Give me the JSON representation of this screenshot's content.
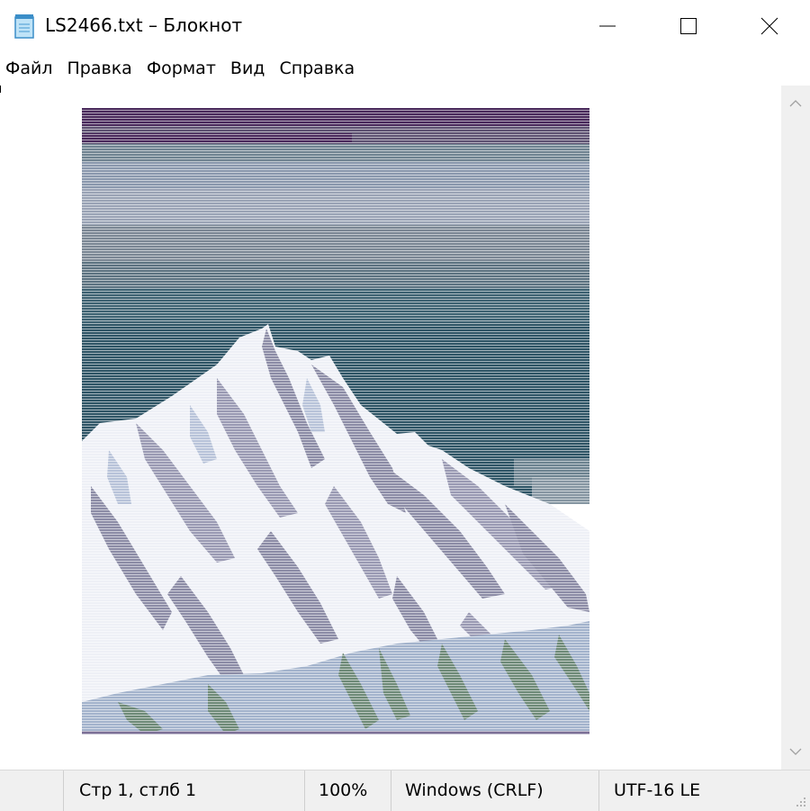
{
  "window": {
    "title": "LS2466.txt – Блокнот",
    "app_icon": "notepad-icon",
    "controls": {
      "minimize_icon": "minimize-icon",
      "maximize_icon": "maximize-icon",
      "close_icon": "close-icon"
    }
  },
  "menu": {
    "items": [
      "Файл",
      "Правка",
      "Формат",
      "Вид",
      "Справка"
    ]
  },
  "editor": {
    "content": "ascii-art: snow-covered mountain peak under layered sky (rendered as fine horizontal text lines)"
  },
  "scrollbar": {
    "up_icon": "chevron-up-icon",
    "down_icon": "chevron-down-icon"
  },
  "status": {
    "position": "Стр 1, стлб 1",
    "zoom": "100%",
    "line_endings": "Windows (CRLF)",
    "encoding": "UTF-16 LE"
  },
  "colors": {
    "sky_top": "#4a2a5c",
    "sky_mid": "#6f8391",
    "sky_low": "#2f5566",
    "snow": "#eef0f6",
    "shadow": "#8c8ca6",
    "foothills": "#a3b3cc",
    "rocks": "#6e8a78"
  }
}
